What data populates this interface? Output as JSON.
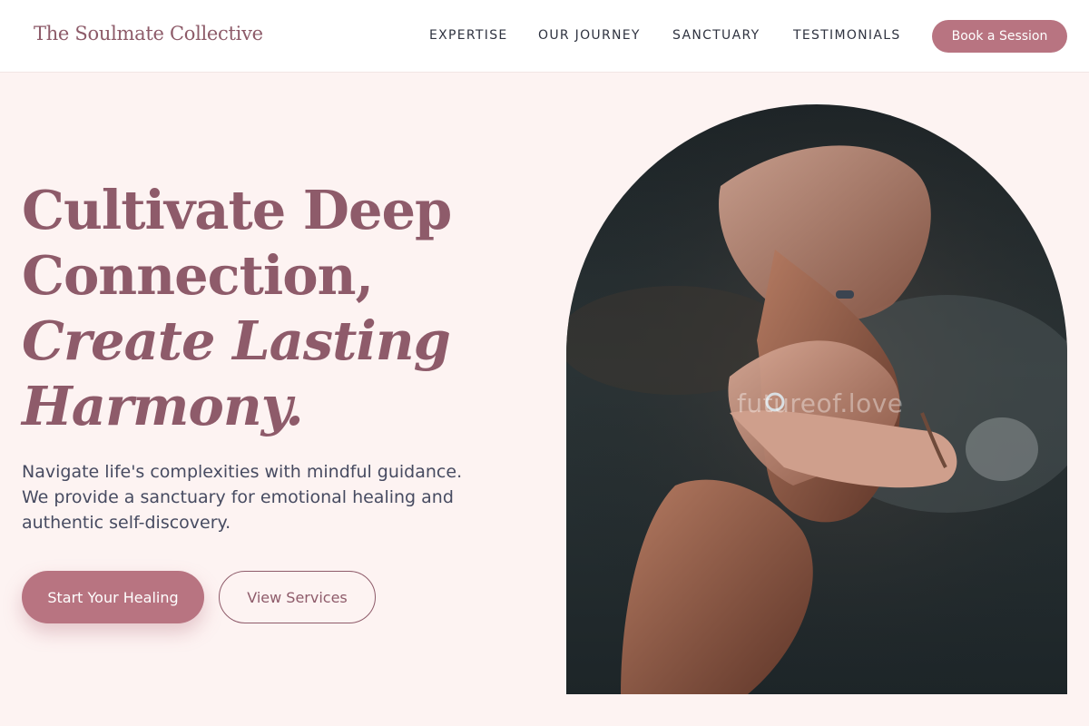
{
  "header": {
    "brand": "The Soulmate Collective",
    "nav": [
      "EXPERTISE",
      "OUR JOURNEY",
      "SANCTUARY",
      "TESTIMONIALS"
    ],
    "cta_label": "Book a Session"
  },
  "hero": {
    "title_lines": [
      "Cultivate Deep",
      "Connection,",
      "Create Lasting",
      "Harmony."
    ],
    "description": "Navigate life's complexities with mindful guidance. We provide a sanctuary for emotional healing and authentic self-discovery.",
    "primary_label": "Start Your Healing",
    "secondary_label": "View Services",
    "image_watermark": "futureof.love"
  },
  "colors": {
    "accent": "#b87481",
    "heading": "#8e5b6a",
    "background": "#fdf3f2"
  }
}
